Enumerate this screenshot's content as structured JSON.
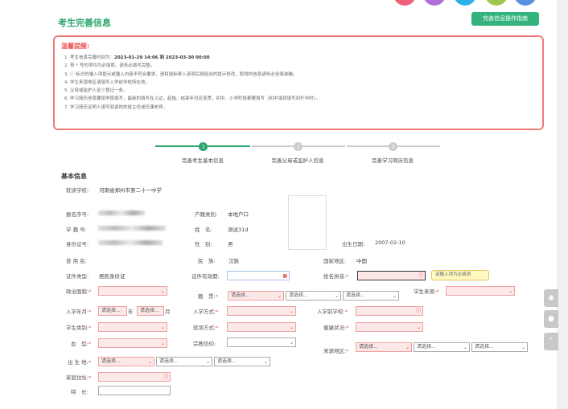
{
  "header": {
    "title": "考生完善信息",
    "guide_button": "完善信息操作指南",
    "circle_colors": [
      "#f0607a",
      "#b070d8",
      "#30b0e8",
      "#a0c850",
      "#5a90e0"
    ]
  },
  "notice": {
    "title": "温馨提醒:",
    "items": [
      {
        "pre": "1. 考生信息完善时间为：",
        "bold": "2023-01-29 14:06 到 2023-03-30 00:00"
      },
      {
        "pre": "2. 带 * 号的项均为必填项，请务必填写完整。"
      },
      {
        "pre": "3. ⓘ 标识的输入项提示或输入内容不符合要求，请将鼠标移入该项后按给出的提示修改，取得的信息请务必全面准确。"
      },
      {
        "pre": "4. 学生来源地区请填写入学前学校所在地。"
      },
      {
        "pre": "5. 父母或监护人至少登记一条。"
      },
      {
        "pre": "6. 学习简历信息要按学段填写，最新的填写在上边，起始、结束年月应连贯，初中、小学阶段都要填写（初中填到填写到升中时）。"
      },
      {
        "pre": "7. 学习简历证明人填写就读时的班主任或任课老师。"
      }
    ]
  },
  "steps": [
    {
      "num": "1",
      "label": "完善考生基本信息",
      "active": true
    },
    {
      "num": "2",
      "label": "完善父母或监护人信息",
      "active": false
    },
    {
      "num": "3",
      "label": "完善学习简历信息",
      "active": false
    }
  ],
  "basic": {
    "section_title": "基本信息",
    "school_label": "就读学校:",
    "school": "河南省郑州市第二十一中学",
    "reg_no_label": "报名序号:",
    "student_no_label": "学 籍 号:",
    "id_no_label": "身份证号:",
    "hukou_label": "户籍类别:",
    "hukou": "本地户口",
    "name_label": "姓　名:",
    "name": "测试31d",
    "gender_label": "性　别:",
    "gender": "男",
    "birth_label": "出生日期:",
    "birth": "2007-02-10",
    "used_name_label": "曾 用 名:",
    "nation_label": "民　族:",
    "nation": "汉族",
    "country_label": "国家地区:",
    "country": "中国",
    "cert_type_label": "证件类型:",
    "cert_type": "居民身份证",
    "cert_valid_label": "证件有效期:",
    "pinyin_label": "姓名拼音:",
    "tooltip": "该输入项为必填项",
    "political_label": "政治面貌:",
    "native_label": "籍　贯:",
    "source_label": "学生来源:",
    "enroll_label": "入学年月:",
    "year": "年",
    "month": "月",
    "enroll_way_label": "入学方式:",
    "prev_school_label": "入学前学校:",
    "category_label": "学生类别:",
    "study_way_label": "就读方式:",
    "health_label": "健康状况:",
    "blood_label": "血　型:",
    "religion_label": "宗教信仰:",
    "source_area_label": "来源地区:",
    "birthplace_label": "出 生 地:",
    "address_label": "家庭住址:",
    "specialty_label": "特　长:",
    "placeholder": "请选择..."
  }
}
